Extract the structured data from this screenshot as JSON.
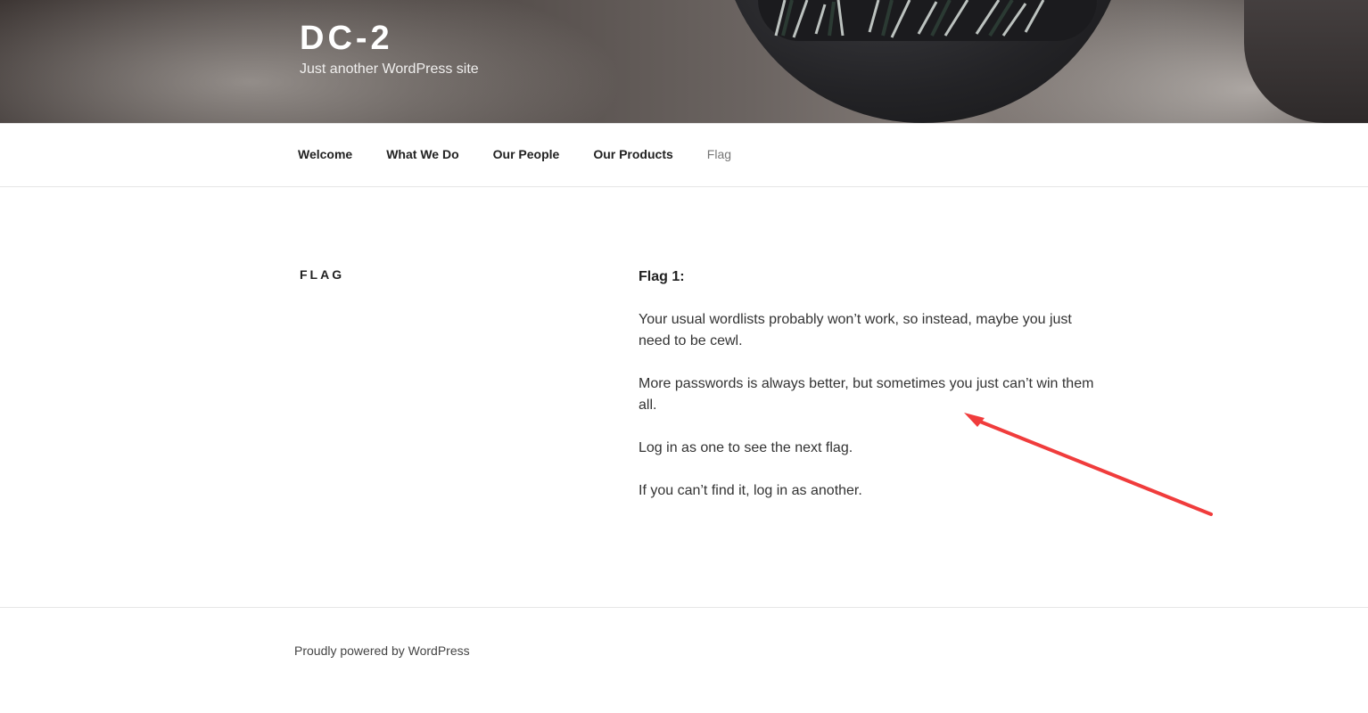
{
  "site": {
    "title": "DC-2",
    "description": "Just another WordPress site"
  },
  "nav": {
    "items": [
      {
        "label": "Welcome"
      },
      {
        "label": "What We Do"
      },
      {
        "label": "Our People"
      },
      {
        "label": "Our Products"
      },
      {
        "label": "Flag",
        "current": true
      }
    ]
  },
  "page": {
    "title": "Flag",
    "paragraphs": [
      "Flag 1:",
      "Your usual wordlists probably won’t work, so instead, maybe you just need to be cewl.",
      "More passwords is always better, but sometimes you just can’t win them all.",
      "Log in as one to see the next flag.",
      "If you can’t find it, log in as another."
    ]
  },
  "annotation": {
    "arrow_color": "#f03c3c"
  },
  "footer": {
    "credit": "Proudly powered by WordPress"
  }
}
